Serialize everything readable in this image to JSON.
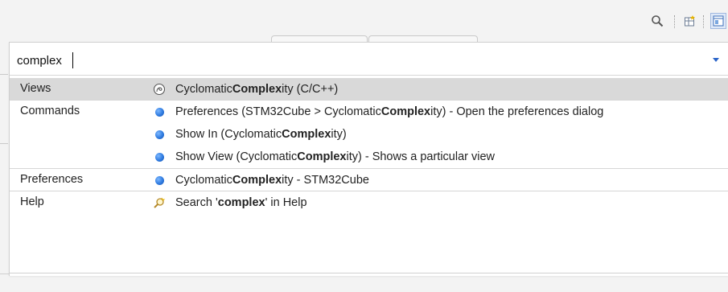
{
  "filter": {
    "value": "complex"
  },
  "groups": [
    {
      "category": "Views",
      "items": [
        {
          "pre": "Cyclomatic ",
          "match": "Complex",
          "post": "ity (C/C++)",
          "icon": "cyclomatic-view-icon"
        }
      ]
    },
    {
      "category": "Commands",
      "items": [
        {
          "pre": "Preferences (STM32Cube > Cyclomatic ",
          "match": "Complex",
          "post": "ity) - Open the preferences dialog",
          "icon": "command-icon"
        },
        {
          "pre": "Show In (Cyclomatic ",
          "match": "Complex",
          "post": "ity)",
          "icon": "command-icon"
        },
        {
          "pre": "Show View (Cyclomatic ",
          "match": "Complex",
          "post": "ity) - Shows a particular view",
          "icon": "command-icon"
        }
      ]
    },
    {
      "category": "Preferences",
      "items": [
        {
          "pre": "Cyclomatic ",
          "match": "Complex",
          "post": "ity - STM32Cube",
          "icon": "preference-icon"
        }
      ]
    },
    {
      "category": "Help",
      "items": [
        {
          "pre": "Search '",
          "match": "complex",
          "post": "' in Help",
          "icon": "help-search-icon"
        }
      ]
    }
  ],
  "toolbar": {
    "icons": [
      "search-icon",
      "open-perspective-icon",
      "perspective-icon"
    ]
  },
  "colors": {
    "selected_row": "#d9d9d9",
    "accent": "#2a64c8"
  }
}
